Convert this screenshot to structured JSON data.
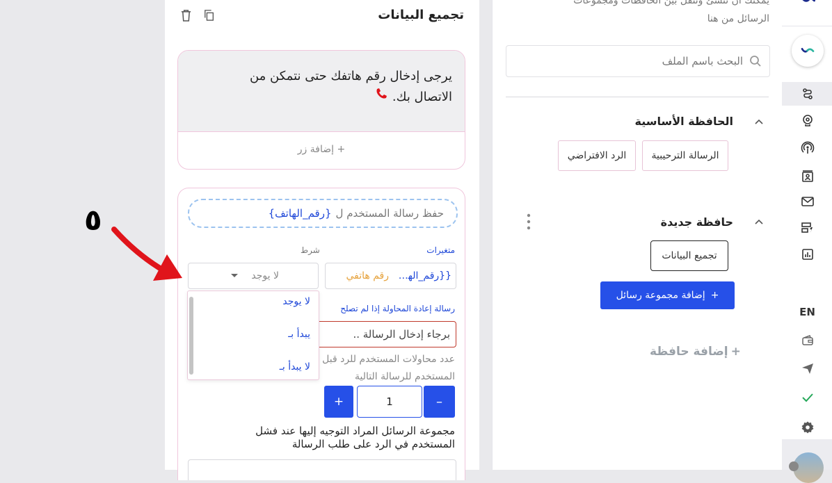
{
  "folder_panel": {
    "intro_line1": "يمكنك ان تنشئ وتنقل بين الحافظات ومجموعات",
    "intro_line2": "الرسائل من هنا",
    "search_placeholder": "البحث باسم الملف",
    "main_folder": {
      "title": "الحافظة الأساسية",
      "items": [
        "الرسالة الترحيبية",
        "الرد الافتراضي"
      ]
    },
    "new_folder": {
      "title": "حافظة جديدة",
      "items": [
        "تجميع البيانات"
      ],
      "add_group_label": "إضافة مجموعة رسائل",
      "add_group_plus": "+"
    },
    "add_folder_label": "إضافة حافظة",
    "add_folder_plus": "+"
  },
  "sidebar": {
    "language": "EN"
  },
  "editor": {
    "title": "تجميع البيانات",
    "message_text": "يرجى إدخال رقم هاتفك حتى نتمكن من الاتصال بك.",
    "add_button_label": "+ إضافة زر",
    "save_reply_text": "حفظ رسالة المستخدم ل",
    "save_reply_variable": "{رقم_الهاتف}",
    "variables_label": "متغيرات",
    "condition_label": "شرط",
    "variable_value": "{{رقم_الهاتف}}",
    "variable_chip": "رقم هاتفي",
    "condition_value": "لا يوجد",
    "condition_options": [
      "لا يوجد",
      "يبدأ بـ",
      "لا يبدأ بـ"
    ],
    "retry_label": "رسالة إعادة المحاولة إذا لم تصلح",
    "retry_placeholder": "برجاء إدخال الرسالة ..",
    "attempts_label_line1": "عدد محاولات المستخدم للرد قبل",
    "attempts_label_line2": "المستخدم للرسالة التالية",
    "attempts_value": "1",
    "stepper_plus": "+",
    "stepper_minus": "–",
    "fail_group_label_line1": "مجموعة الرسائل المراد التوجيه إليها عند فشل",
    "fail_group_label_line2": "المستخدم في الرد على طلب الرسالة"
  },
  "annotation": {
    "number": "٥"
  },
  "colors": {
    "accent_blue": "#2650e8",
    "pink_border": "#f0c6dc",
    "annotation_red": "#e0141b",
    "variable_chip": "#e6a23c"
  }
}
